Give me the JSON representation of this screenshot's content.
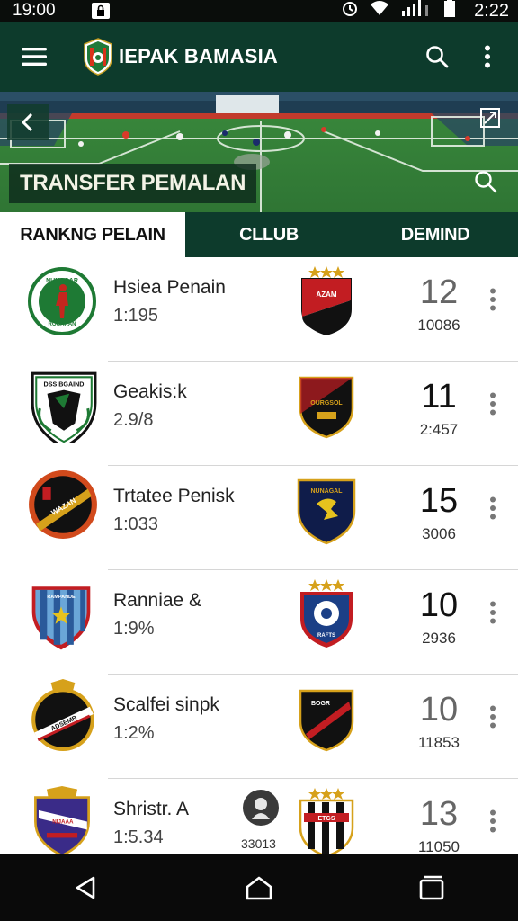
{
  "status": {
    "time_left": "19:00",
    "time_right": "2:22"
  },
  "app": {
    "title": "IEPAK BAMASIA"
  },
  "hero": {
    "banner": "TRANSFER PEMALAN"
  },
  "tabs": [
    {
      "label": "RANKNG PELAIN",
      "active": true
    },
    {
      "label": "CLLUB"
    },
    {
      "label": "DEMIND"
    }
  ],
  "rows": [
    {
      "name": "Hsiea Penain",
      "sub": "1:195",
      "rank": "12",
      "points": "10086",
      "rank_muted": true
    },
    {
      "name": "Geakis:k",
      "sub": "2.9/8",
      "rank": "11",
      "points": "2:457"
    },
    {
      "name": "Trtatee Penisk",
      "sub": "1:033",
      "rank": "15",
      "points": "3006"
    },
    {
      "name": "Ranniae &",
      "sub": "1:9%",
      "rank": "10",
      "points": "2936"
    },
    {
      "name": "Scalfei sinpk",
      "sub": "1:2%",
      "rank": "10",
      "points": "11853",
      "rank_muted": true
    },
    {
      "name": "Shristr. A",
      "sub": "1:5.34",
      "rank": "13",
      "points": "11050",
      "rank_muted": true,
      "extra_count": "33013"
    }
  ],
  "badge_text": {
    "r0_player": "NUNAGAR",
    "r0_player_b": "ROGAKAN",
    "r0_club": "AZAM",
    "r1_player": "DSS BGAIND",
    "r1_club": "OURGSOL",
    "r2_player": "WAZAN",
    "r2_club": "NUNAGAL",
    "r3_player": "RAMPANDE",
    "r3_club": "RAFTS",
    "r4_player": "ADSEMB",
    "r4_club": "BOGR",
    "r5_player": "NIJAAA",
    "r5_club": "ETGS"
  },
  "colors": {
    "primary": "#0d3b2c",
    "pitch": "#3f8a3a",
    "nav": "#0a0a0a"
  }
}
